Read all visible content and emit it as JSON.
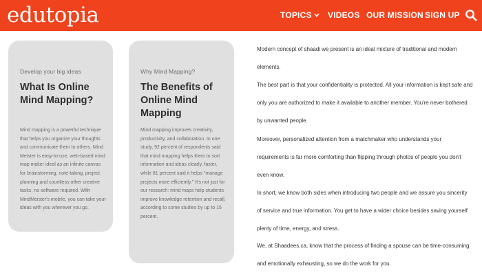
{
  "header": {
    "logo": "edutopia",
    "nav": {
      "topics": "TOPICS",
      "videos": "VIDEOS",
      "mission": "OUR MISSION",
      "signup": "SIGN UP"
    },
    "icons": {
      "dropdown": "chevron-down-icon",
      "search": "search-icon"
    }
  },
  "cards": [
    {
      "kicker": "Develop your big ideas",
      "title": "What Is Online Mind Mapping?",
      "body": "Mind mapping is a powerful technique that helps you organize your thoughts and communicate them to others. Mind Meister is easy-to-use, web-based mind map maker ideal as an infinite canvas for brainstorming, note-taking, project planning and countless other creative tasks, no software required. With MindMeister's mobile, you can take your ideas with you wherever you go."
    },
    {
      "kicker": "Why Mind Mapping?",
      "title": "The Benefits of Online Mind Mapping",
      "body": "Mind mapping improves creativity, productivity, and collaboration. In one study, 92 percent of respondents said that mind mapping helps them to sort information and ideas clearly, faster, while 81 percent said it helps \"manage projects more efficiently.\" It's not just for our research: mind maps help students improve knowledge retention and recall, according to some studies by up to 15 percent."
    }
  ],
  "article": {
    "paragraphs": [
      "Modern concept of shaadi we present is an ideal mixture of traditional and modern elements.",
      "The best part is that your confidentiality is protected. All your information is kept safe and only you are authorized to make it available to another member. You're never bothered by unwanted people.",
      "Moreover, personalized attention from a matchmaker who understands your requirements is far more comforting than flipping through photos of people you don't even know.",
      "In short, we know both sides when introducing two people and we assure you sincerity of service and true information. You get to have a wider choice besides saving yourself plenty of time, energy, and stress.",
      "We, at Shaadees.ca, know that the process of finding a spouse can be time-consuming and emotionally exhausting, so we do the work for you."
    ]
  },
  "colors": {
    "brand": "#f0421c",
    "card_bg": "#e0e0e0",
    "title_text": "#2e2e2e",
    "body_text": "#6a6a6a"
  }
}
